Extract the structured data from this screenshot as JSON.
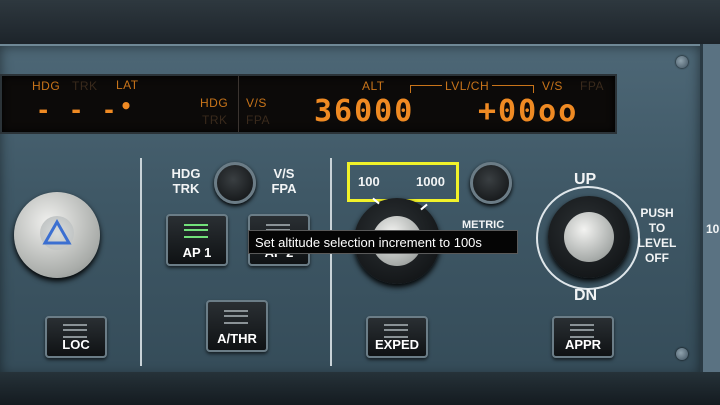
{
  "display": {
    "hdg_label": "HDG",
    "trk_label": "TRK",
    "lat_label": "LAT",
    "hdg_value": "- - -",
    "lat_dot": "•",
    "hdg_vs_label": "HDG",
    "vs_label": "V/S",
    "trk_lower": "TRK",
    "fpa_lower": "FPA",
    "alt_label": "ALT",
    "lvlch_label": "LVL/CH",
    "vs_right_label": "V/S",
    "fpa_right_label": "FPA",
    "altitude_value": "36000",
    "vs_value": "+00oo"
  },
  "panel": {
    "hdg_trk_label": "HDG\nTRK",
    "vs_fpa_label": "V/S\nFPA",
    "alt_inc_100": "100",
    "alt_inc_1000": "1000",
    "metric_label": "METRIC",
    "up_label": "UP",
    "dn_label": "DN",
    "push_label": "PUSH\nTO\nLEVEL\nOFF",
    "edge_digits": "10"
  },
  "buttons": {
    "loc": "LOC",
    "ap1": "AP 1",
    "ap2": "AP 2",
    "athr": "A/THR",
    "exped": "EXPED",
    "appr": "APPR"
  },
  "tooltip": {
    "text": "Set altitude selection increment to 100s"
  },
  "colors": {
    "display_orange": "#ef8a23",
    "highlight_yellow": "#f1f22a",
    "ap1_light_green": "#72e07a"
  }
}
